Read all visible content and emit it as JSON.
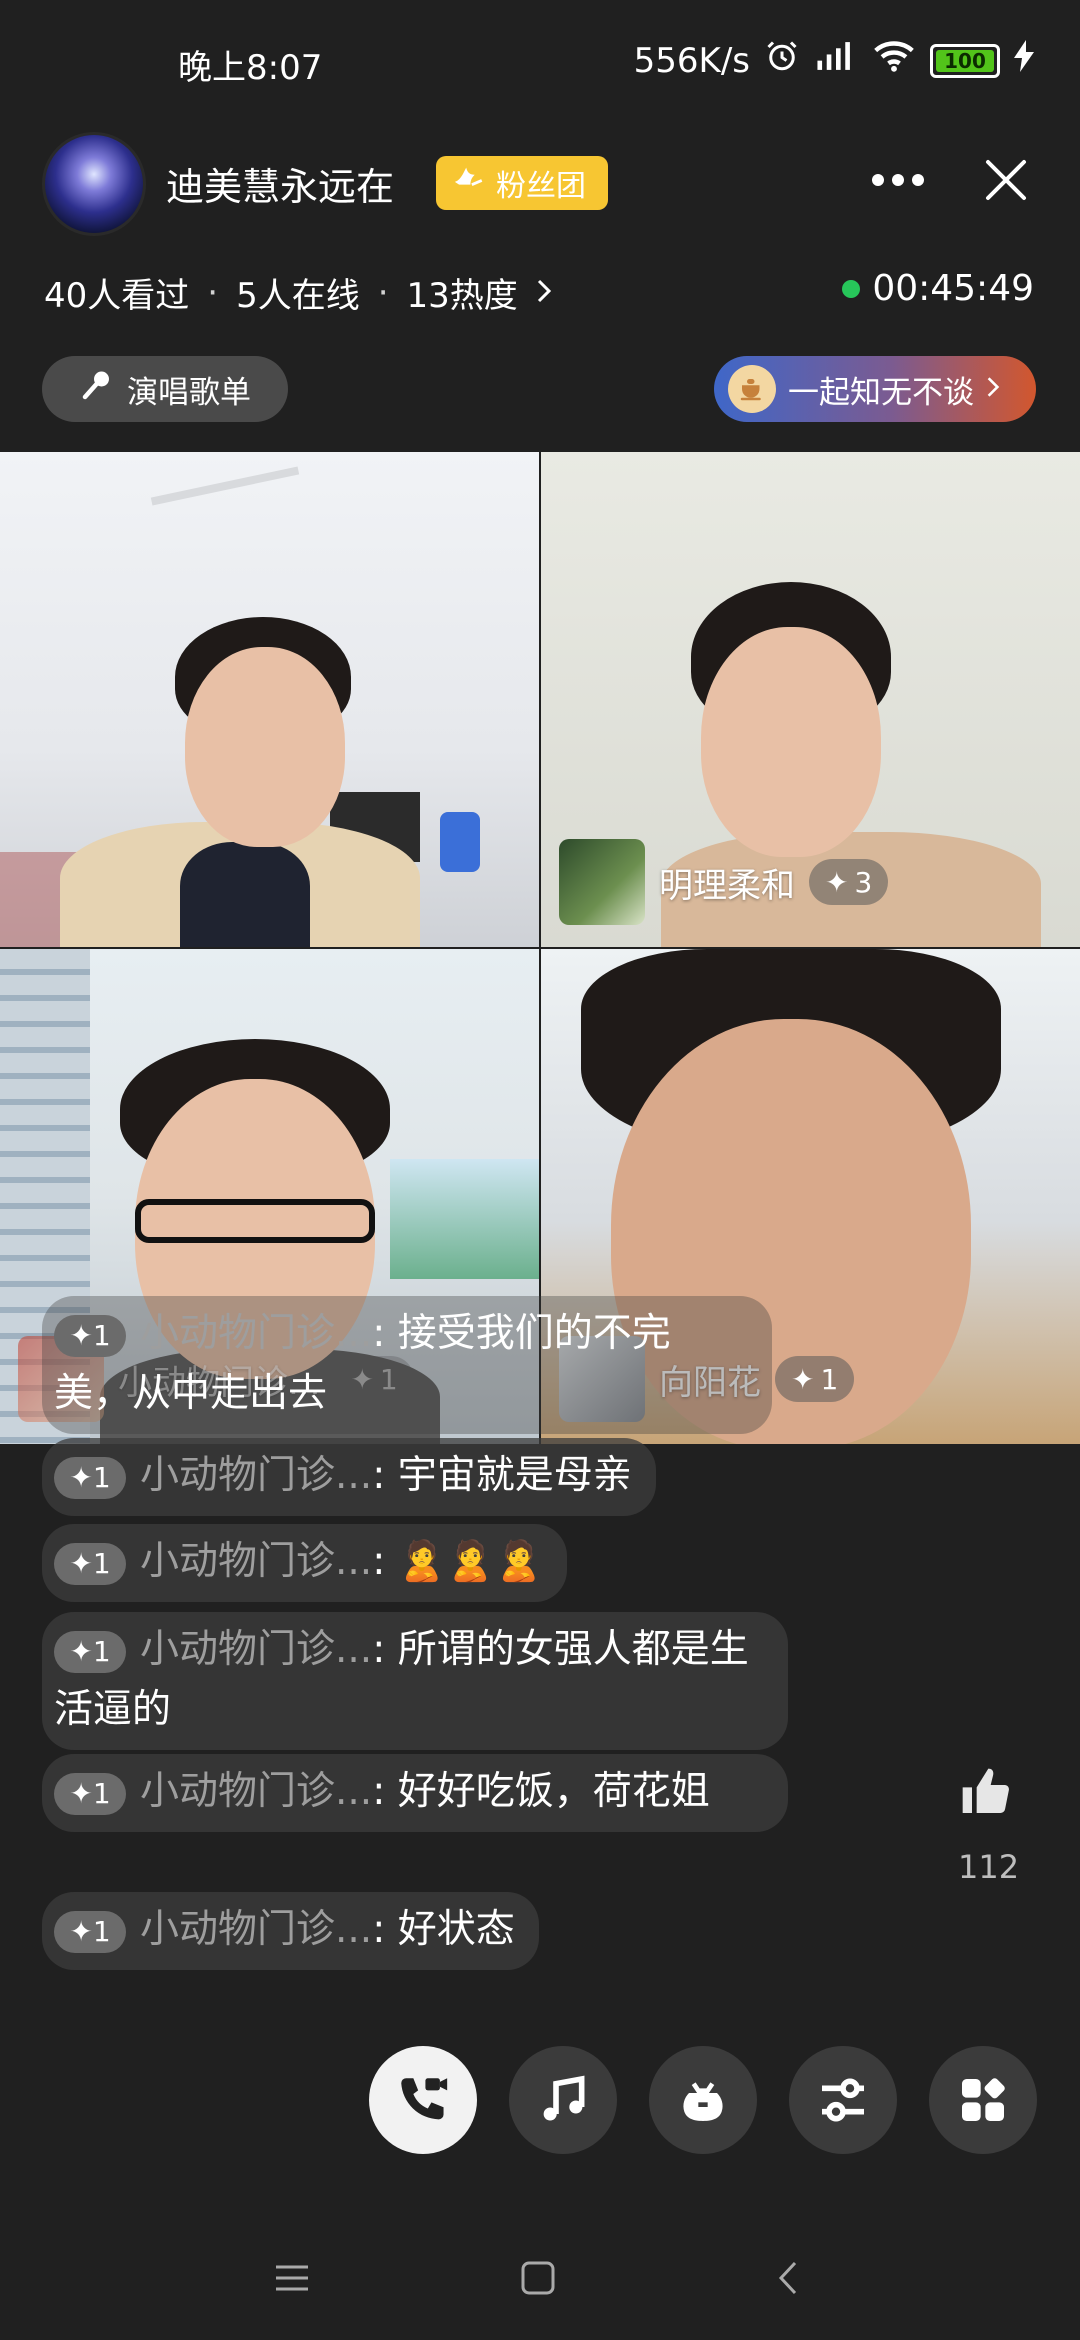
{
  "status_bar": {
    "time": "晚上8:07",
    "net_speed": "556K/s",
    "battery": "100"
  },
  "header": {
    "host_name": "迪美慧永远在",
    "fan_badge": "粉丝团",
    "viewed": "40人看过",
    "online": "5人在线",
    "heat": "13热度",
    "timer": "00:45:49",
    "song_list": "演唱歌单",
    "topic": "一起知无不谈"
  },
  "tiles": [
    {
      "name": "",
      "plus": ""
    },
    {
      "name": "明理柔和",
      "plus": "3"
    },
    {
      "name": "小动物门诊...",
      "plus": "1"
    },
    {
      "name": "向阳花",
      "plus": "1"
    }
  ],
  "chat": [
    {
      "level": "1",
      "sender": "小动物门诊...",
      "sep": ":",
      "text": "接受我们的不完美，从中走出去"
    },
    {
      "level": "1",
      "sender": "小动物门诊...",
      "sep": ":",
      "text": "宇宙就是母亲"
    },
    {
      "level": "1",
      "sender": "小动物门诊...",
      "sep": ":",
      "text": "🙎🙎🙎"
    },
    {
      "level": "1",
      "sender": "小动物门诊...",
      "sep": ":",
      "text": "所谓的女强人都是生活逼的"
    },
    {
      "level": "1",
      "sender": "小动物门诊...",
      "sep": ":",
      "text": "好好吃饭，荷花姐"
    },
    {
      "level": "1",
      "sender": "小动物门诊...",
      "sep": ":",
      "text": "好状态"
    }
  ],
  "likes": "112",
  "colors": {
    "accent_gold": "#f7c632",
    "live_green": "#27c65a",
    "background": "#202020"
  }
}
